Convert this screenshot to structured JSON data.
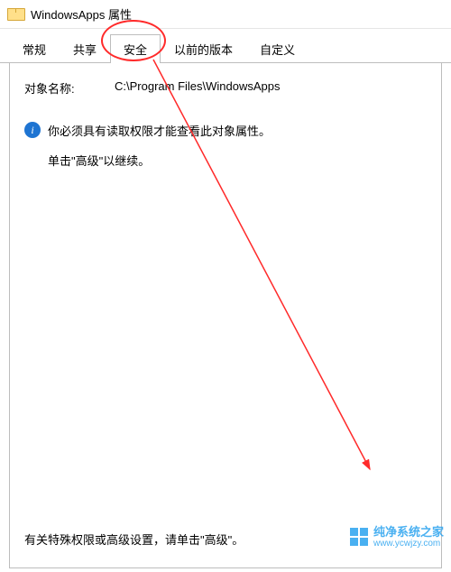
{
  "window": {
    "title": "WindowsApps 属性"
  },
  "tabs": [
    {
      "label": "常规"
    },
    {
      "label": "共享"
    },
    {
      "label": "安全"
    },
    {
      "label": "以前的版本"
    },
    {
      "label": "自定义"
    }
  ],
  "active_tab_index": 2,
  "security": {
    "object_label": "对象名称:",
    "object_value": "C:\\Program Files\\WindowsApps",
    "info_message": "你必须具有读取权限才能查看此对象属性。",
    "continue_hint": "单击\"高级\"以继续。",
    "advanced_note": "有关特殊权限或高级设置，请单击\"高级\"。"
  },
  "watermark": {
    "line1": "纯净系统之家",
    "line2": "www.ycwjzy.com"
  },
  "annotation": {
    "circle_target": "安全",
    "arrow_color": "#ff2a2a"
  }
}
